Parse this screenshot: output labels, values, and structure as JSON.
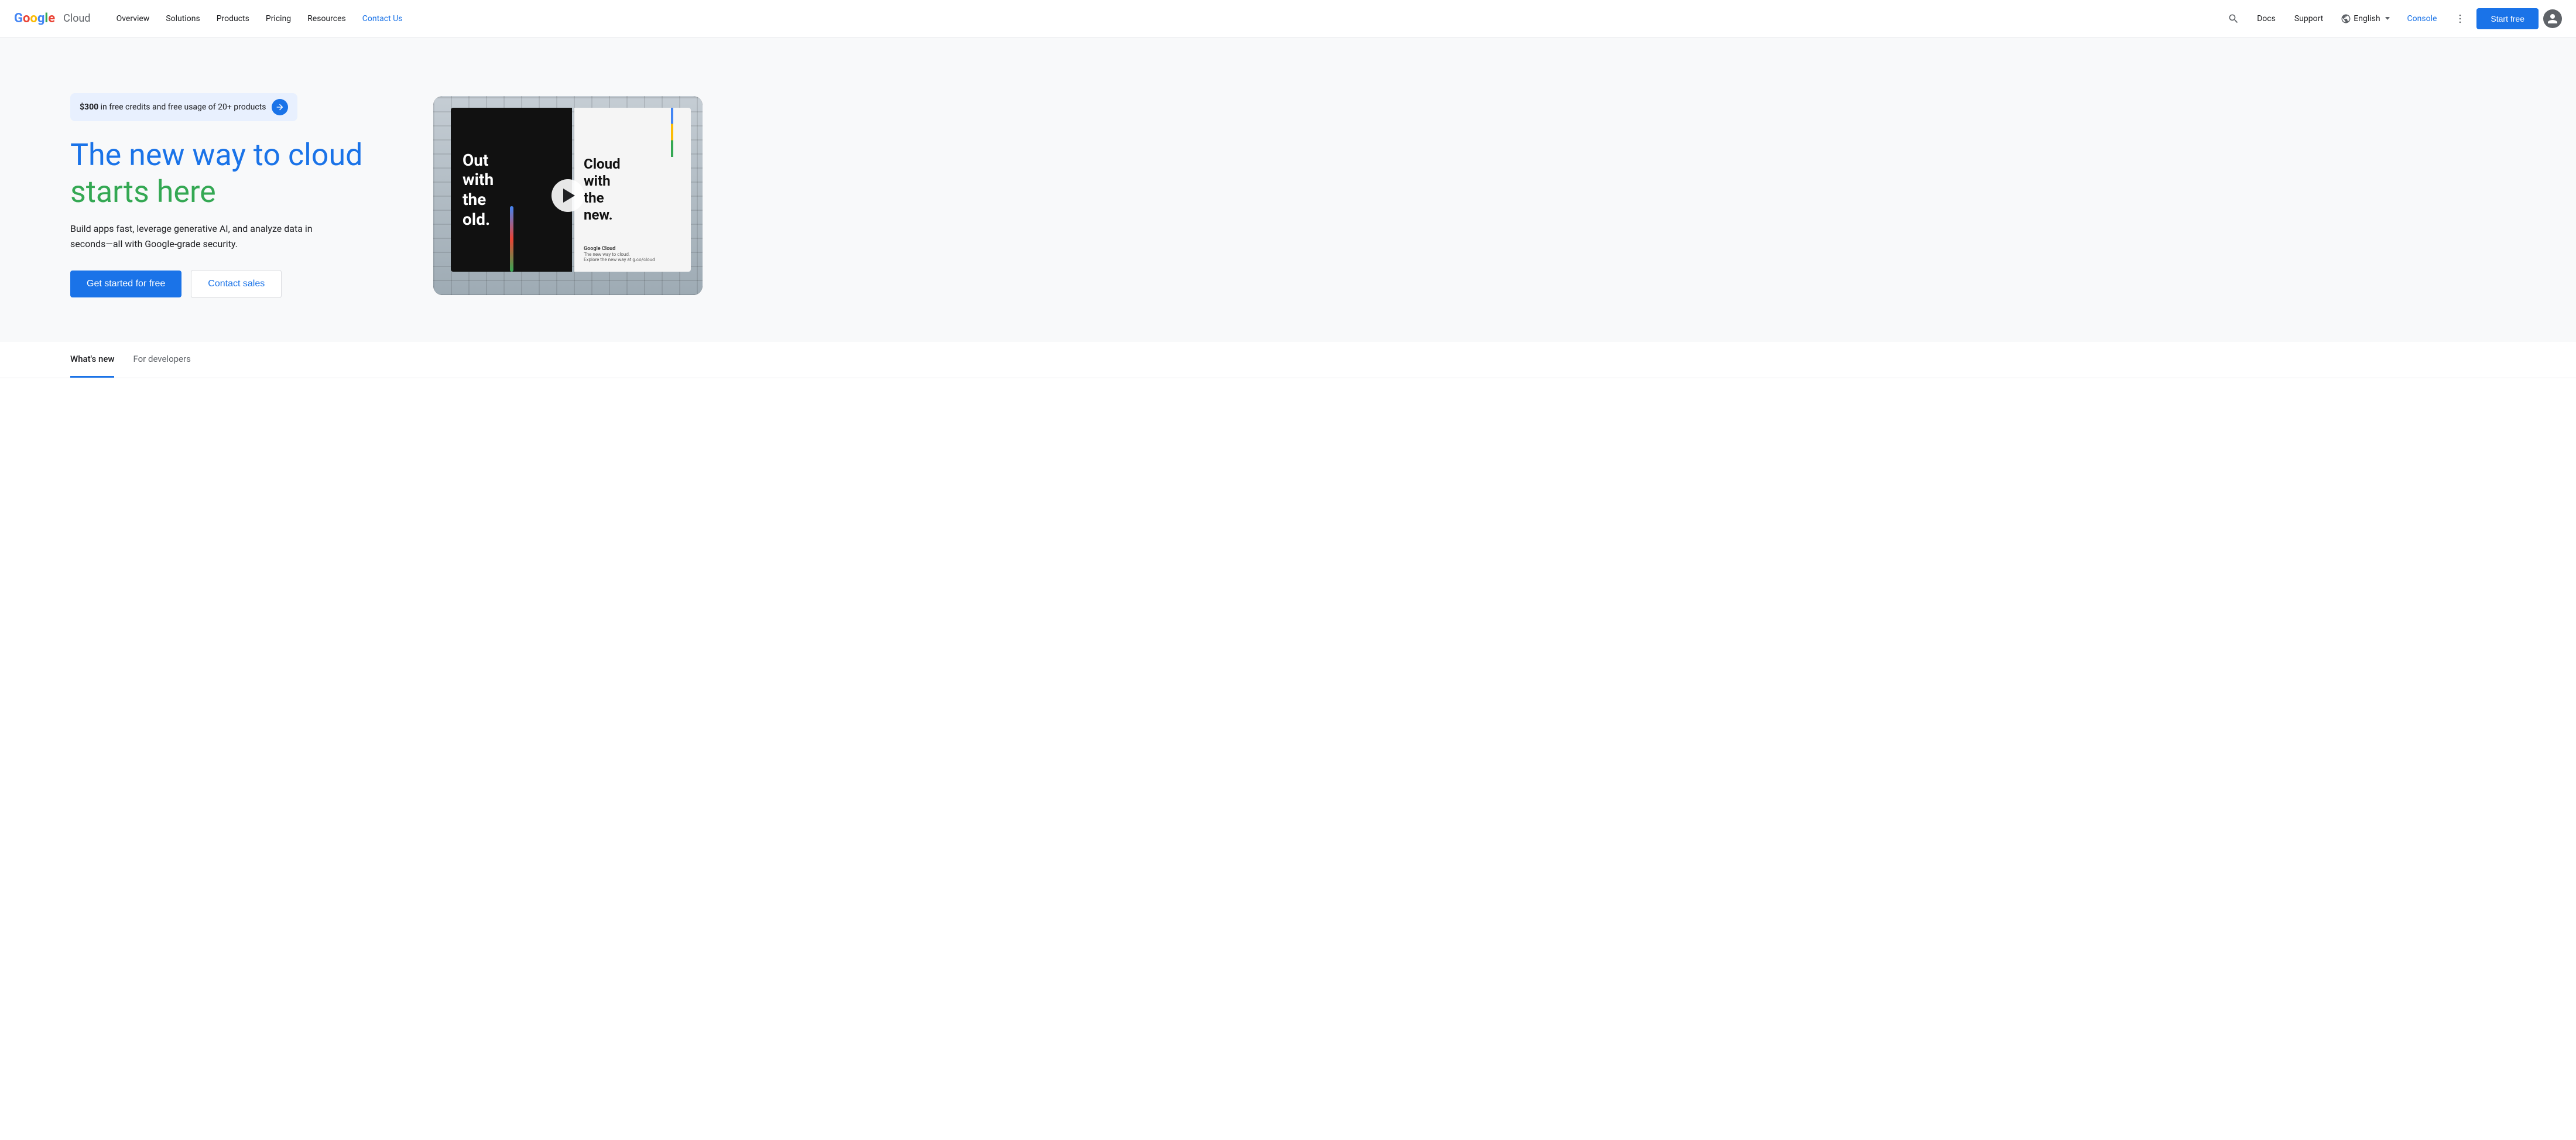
{
  "navbar": {
    "logo": {
      "google": "Google",
      "cloud": "Cloud"
    },
    "links": [
      {
        "id": "overview",
        "label": "Overview"
      },
      {
        "id": "solutions",
        "label": "Solutions"
      },
      {
        "id": "products",
        "label": "Products"
      },
      {
        "id": "pricing",
        "label": "Pricing"
      },
      {
        "id": "resources",
        "label": "Resources"
      },
      {
        "id": "contact-us",
        "label": "Contact Us",
        "active": true
      }
    ],
    "search_label": "Search",
    "docs_label": "Docs",
    "support_label": "Support",
    "language": "English",
    "console_label": "Console",
    "start_free_label": "Start free"
  },
  "hero": {
    "promo_text_bold": "$300",
    "promo_text_rest": " in free credits and free usage of 20+ products",
    "title_line1": "The new way to cloud",
    "title_line2": "starts here",
    "subtitle": "Build apps fast, leverage generative AI, and analyze data in seconds—all with Google-grade security.",
    "cta_primary": "Get started for free",
    "cta_secondary": "Contact sales",
    "video_alt": "Google Cloud billboard video - Out with the old, Cloud with the new.",
    "billboard_left_text": "Out\nwith\nthe\nold.",
    "billboard_right_text": "Cloud\nwith\nthe\nnew.",
    "billboard_brand": "Google Cloud",
    "billboard_tagline": "The new way to cloud.",
    "billboard_url_text": "Explore the new way at g.co/cloud"
  },
  "tabs": [
    {
      "id": "whats-new",
      "label": "What's new",
      "active": true
    },
    {
      "id": "for-developers",
      "label": "For developers",
      "active": false
    }
  ]
}
